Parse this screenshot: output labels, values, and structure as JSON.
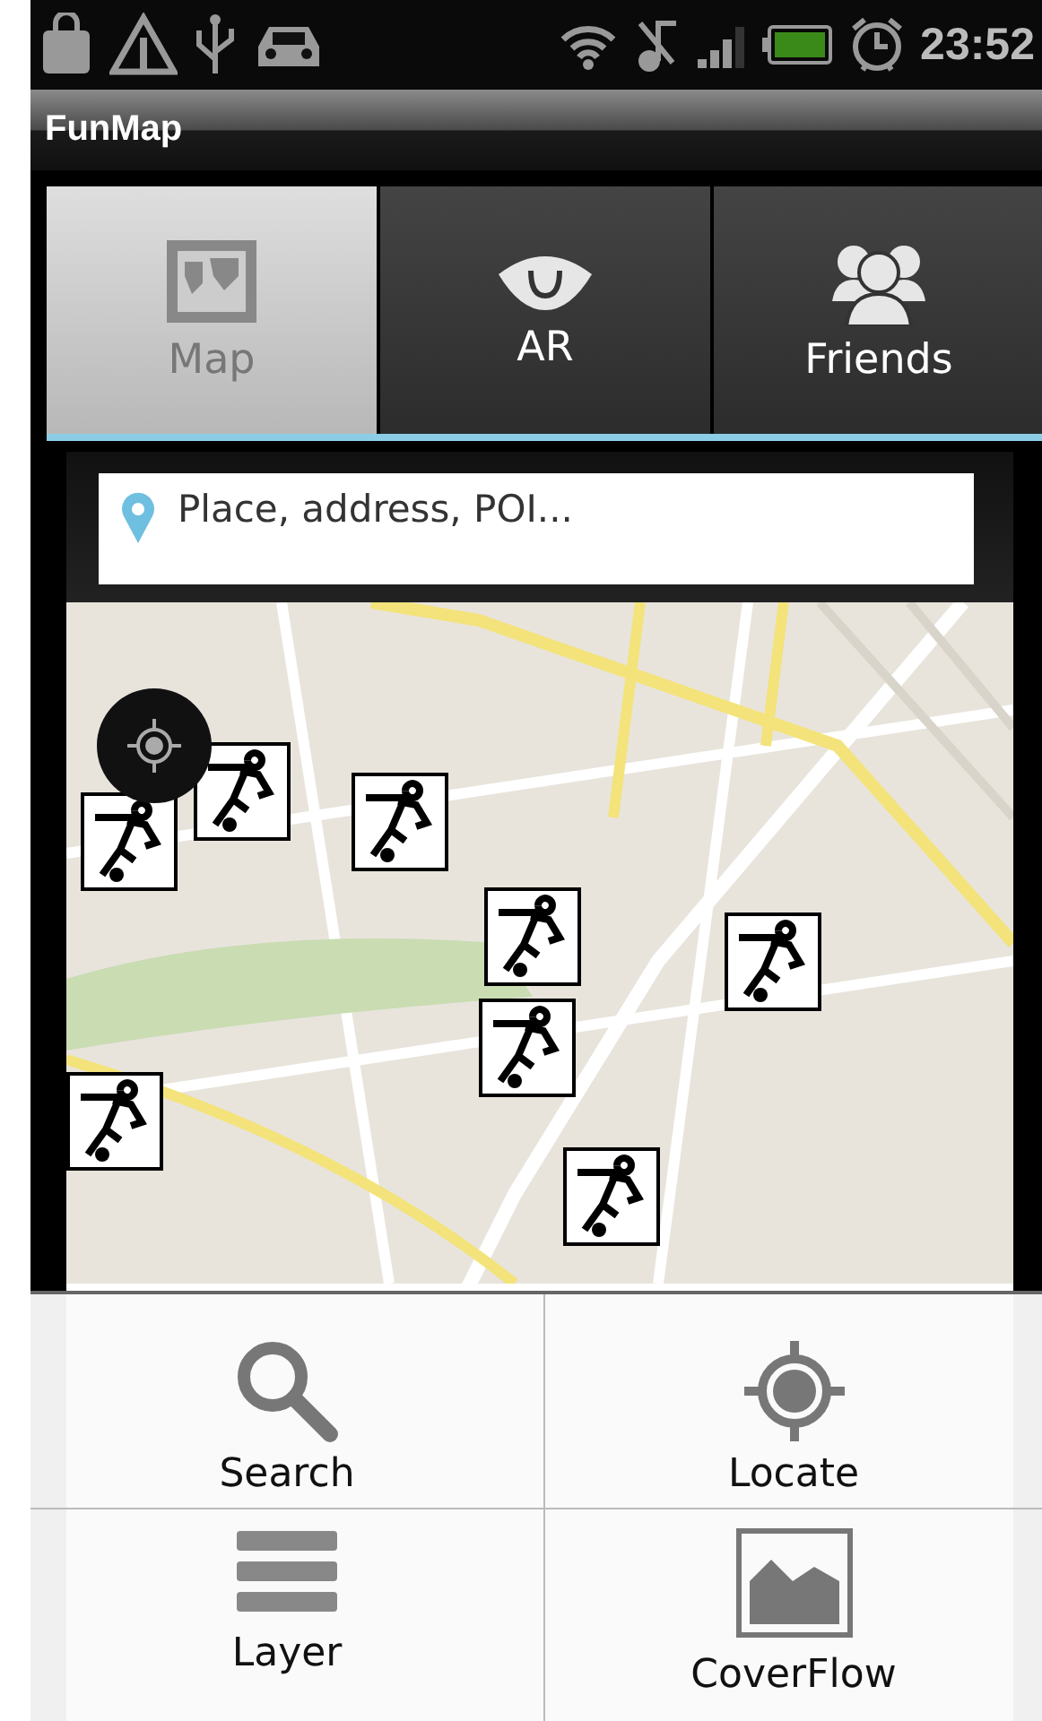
{
  "status_bar": {
    "time": "23:52"
  },
  "app_bar": {
    "title": "FunMap"
  },
  "tabs": [
    {
      "label": "Map",
      "selected": true
    },
    {
      "label": "AR",
      "selected": false
    },
    {
      "label": "Friends",
      "selected": false
    }
  ],
  "search": {
    "placeholder": "Place, address, POI..."
  },
  "menu": {
    "items": [
      {
        "label": "Search"
      },
      {
        "label": "Locate"
      },
      {
        "label": "Layer"
      },
      {
        "label": "CoverFlow"
      }
    ]
  }
}
